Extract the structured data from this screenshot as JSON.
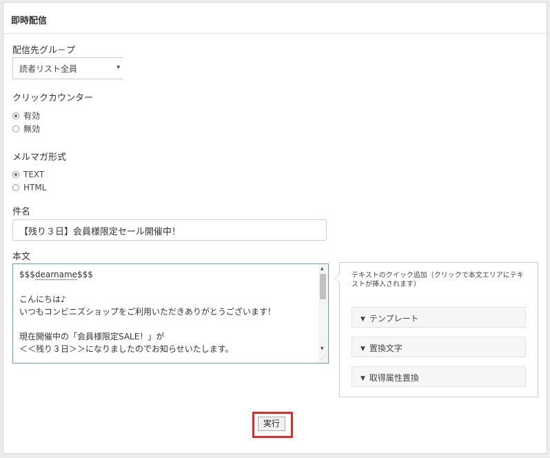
{
  "header": {
    "title": "即時配信"
  },
  "group": {
    "label": "配信先グル－プ",
    "selected": "読者リスト全員",
    "caret": "▾"
  },
  "click_counter": {
    "label": "クリックカウンター",
    "options": [
      "有効",
      "無効"
    ],
    "selected": "有効"
  },
  "format": {
    "label": "メルマガ形式",
    "options": [
      "TEXT",
      "HTML"
    ],
    "selected": "TEXT"
  },
  "subject": {
    "label": "件名",
    "value": "【残り３日】会員様限定セール開催中！"
  },
  "body": {
    "label": "本文",
    "lines": [
      "",
      "",
      "こんにちは♪",
      "いつもコンビニズショップをご利用いただきありがとうございます！",
      "",
      "現在開催中の「会員様限定SALE！」が",
      "＜＜残り３日＞＞になりましたのでお知らせいたします。"
    ],
    "line1_prefix": "$$$",
    "line1_link": "dearname",
    "line1_suffix": "$$$"
  },
  "quick_add": {
    "title": "テキストのクイック追加（クリックで本文エリアにテキストが挿入されます）",
    "sections": [
      "テンプレート",
      "置換文字",
      "取得属性置換"
    ]
  },
  "actions": {
    "run_label": "実行"
  }
}
